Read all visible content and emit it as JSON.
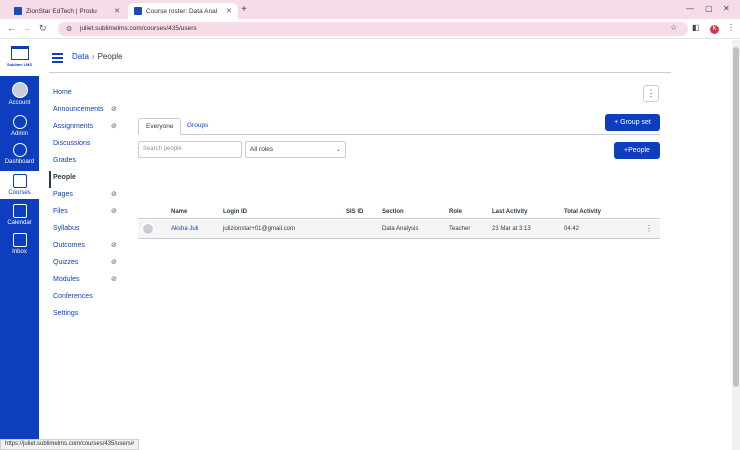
{
  "browser": {
    "tabs": [
      {
        "title": "ZionStar EdTech | Produ"
      },
      {
        "title": "Course roster: Data Anal"
      }
    ],
    "url": "juliet.sublimelms.com/courses/435/users",
    "status_url": "https://juliet.sublimelms.com/courses/435/users#",
    "profile_initial": "K"
  },
  "brand": {
    "logo_text": "Sublime LMS"
  },
  "global_nav": [
    {
      "label": "Account",
      "icon": "user-icon"
    },
    {
      "label": "Admin",
      "icon": "shield-icon"
    },
    {
      "label": "Dashboard",
      "icon": "dashboard-icon"
    },
    {
      "label": "Courses",
      "icon": "book-icon",
      "active": true
    },
    {
      "label": "Calendar",
      "icon": "calendar-icon"
    },
    {
      "label": "Inbox",
      "icon": "inbox-icon"
    }
  ],
  "breadcrumb": {
    "course": "Data",
    "current": "People"
  },
  "course_nav": [
    {
      "label": "Home"
    },
    {
      "label": "Announcements",
      "hidden": true
    },
    {
      "label": "Assignments",
      "hidden": true
    },
    {
      "label": "Discussions"
    },
    {
      "label": "Grades"
    },
    {
      "label": "People",
      "active": true
    },
    {
      "label": "Pages",
      "hidden": true
    },
    {
      "label": "Files",
      "hidden": true
    },
    {
      "label": "Syllabus"
    },
    {
      "label": "Outcomes",
      "hidden": true
    },
    {
      "label": "Quizzes",
      "hidden": true
    },
    {
      "label": "Modules",
      "hidden": true
    },
    {
      "label": "Conferences"
    },
    {
      "label": "Settings"
    }
  ],
  "tabs": {
    "everyone": "Everyone",
    "groups": "Groups"
  },
  "buttons": {
    "group_set": "Group set",
    "people": "People"
  },
  "search": {
    "placeholder": "Search people"
  },
  "roles_select": {
    "value": "All roles"
  },
  "table": {
    "headers": {
      "name": "Name",
      "login_id": "Login ID",
      "sis_id": "SIS ID",
      "section": "Section",
      "role": "Role",
      "last_activity": "Last Activity",
      "total_activity": "Total Activity"
    },
    "rows": [
      {
        "name": "Aksha Juli",
        "login_id": "julizionstar+01@gmail.com",
        "sis_id": "",
        "section": "Data Analysis",
        "role": "Teacher",
        "last_activity": "23 Mar at 3:13",
        "total_activity": "04:42"
      }
    ]
  },
  "colors": {
    "brand": "#0d3ebd",
    "tabbar": "#f6dce8"
  }
}
